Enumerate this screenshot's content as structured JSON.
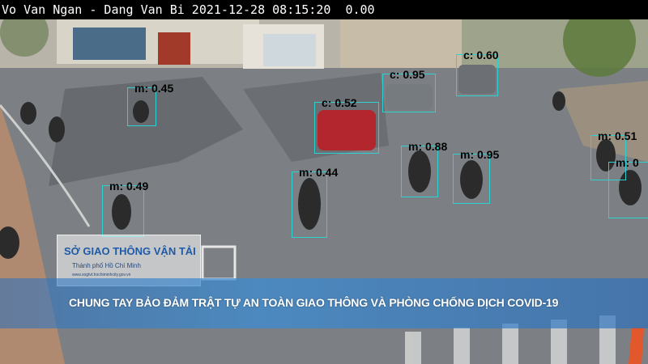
{
  "overlay": {
    "caption": "Vo Van Ngan - Dang Van Bi 2021-12-28 08:15:20  0.00"
  },
  "detections": [
    {
      "label": "m: 0.45",
      "class": "m",
      "score": 0.45
    },
    {
      "label": "m: 0.49",
      "class": "m",
      "score": 0.49
    },
    {
      "label": "m: 0.44",
      "class": "m",
      "score": 0.44
    },
    {
      "label": "c: 0.52",
      "class": "c",
      "score": 0.52
    },
    {
      "label": "c: 0.95",
      "class": "c",
      "score": 0.95
    },
    {
      "label": "c: 0.60",
      "class": "c",
      "score": 0.6
    },
    {
      "label": "m: 0.88",
      "class": "m",
      "score": 0.88
    },
    {
      "label": "m: 0.95",
      "class": "m",
      "score": 0.95
    },
    {
      "label": "m: 0.51",
      "class": "m",
      "score": 0.51
    },
    {
      "label": "m: 0",
      "class": "m",
      "score": 0
    }
  ],
  "logo": {
    "title": "SỞ GIAO THÔNG VẬN TẢI",
    "subtitle": "Thành phố Hồ Chí Minh",
    "url": "www.sogtvt.hochiminhcity.gov.vn"
  },
  "banner": {
    "text": "CHUNG TAY BẢO ĐẢM TRẬT TỰ AN TOÀN GIAO THÔNG VÀ PHÒNG CHỐNG DỊCH COVID-19"
  },
  "colors": {
    "box": "#2fd0d0",
    "banner": "#3c8cd2"
  }
}
